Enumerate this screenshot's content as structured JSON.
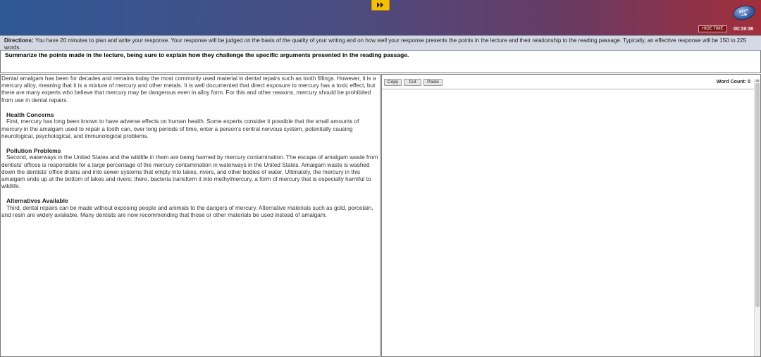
{
  "header": {
    "next_label": "NEXT",
    "hide_time_label": "HIDE TIME",
    "timer": "00:19:36",
    "colors": {
      "gradient_left": "#2f5996",
      "gradient_right": "#a22e3a",
      "fast_forward": "#f5c000",
      "hide_time_bg": "#7a1616"
    }
  },
  "directions": {
    "label": "Directions:",
    "text": " You have 20 minutes to plan and write your response. Your response will be judged on the basis of the quality of your writing and on how well your response presents the points in the lecture and their relationship to the reading passage. Typically, an effective response will be 150 to 225 words."
  },
  "prompt": {
    "text": "Summarize the points made in the lecture, being sure to explain how they challenge the specific arguments presented in the reading passage."
  },
  "reading": {
    "intro": "Dental amalgam has been for decades and remains today the most commonly used material in dental repairs such as tooth fillings. However, it is a mercury alloy, meaning that it is a mixture of mercury and other metals. It is well documented that direct exposure to mercury has a toxic effect, but there are many experts who believe that mercury may be dangerous even in alloy form. For this and other reasons, mercury should be prohibited from use in dental repairs.",
    "sections": [
      {
        "heading": "Health Concerns",
        "body": "First, mercury has long been known to have adverse effects on human health. Some experts consider it possible that the small amounts of mercury in the amalgam used to repair a tooth can, over long periods of time, enter a person's central nervous system, potentially causing neurological, psychological, and immunological problems."
      },
      {
        "heading": "Pollution Problems",
        "body": "Second, waterways in the United States and the wildlife in them are being harmed by mercury contamination. The escape of amalgam waste from dentists' offices is responsible for a large percentage of the mercury contamination in waterways in the United States. Amalgam waste is washed down the dentists' office drains and into sewer systems that empty into lakes, rivers, and other bodies of water. Ultimately, the mercury in this amalgam ends up at the bottom of lakes and rivers; there, bacteria transform it into methylmercury, a form of mercury that is especially harmful to wildlife."
      },
      {
        "heading": "Alternatives Available",
        "body": "Third, dental repairs can be made without exposing people and animals to the dangers of mercury. Alternative materials such as gold, porcelain, and resin are widely available. Many dentists are now recommending that those or other materials be used instead of amalgam."
      }
    ]
  },
  "writing": {
    "copy_label": "Copy",
    "cut_label": "Cut",
    "paste_label": "Paste",
    "word_count": "Word Count: 0",
    "editor_value": ""
  }
}
